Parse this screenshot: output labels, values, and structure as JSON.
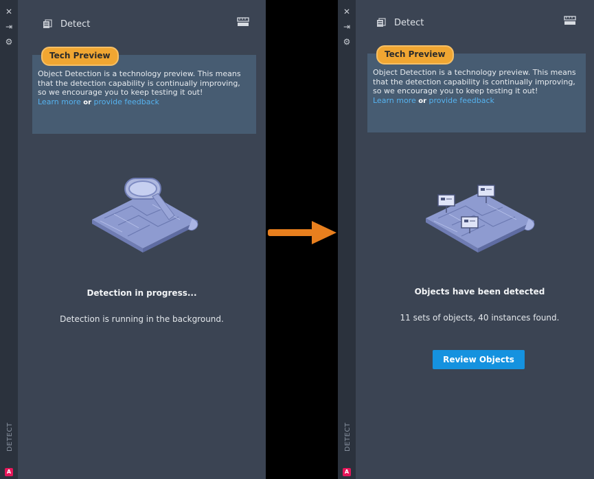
{
  "panels": {
    "left": {
      "title": "Detect",
      "badge": "Tech Preview",
      "info_text": "Object Detection is a technology preview. This means that the detection capability is continually improving, so we encourage you to keep testing it out!",
      "learn_more": "Learn more",
      "or": "or",
      "feedback": "provide feedback",
      "status_title": "Detection in progress...",
      "status_text": "Detection is running in the background.",
      "side_label": "DETECT",
      "side_icons": [
        "close-icon",
        "pin-icon",
        "settings-icon"
      ]
    },
    "right": {
      "title": "Detect",
      "badge": "Tech Preview",
      "info_text": "Object Detection is a technology preview. This means that the detection capability is continually improving, so we encourage you to keep testing it out!",
      "learn_more": "Learn more",
      "or": "or",
      "feedback": "provide feedback",
      "status_title": "Objects have been detected",
      "status_text": "11 sets of objects, 40 instances found.",
      "button_label": "Review Objects",
      "side_label": "DETECT",
      "side_icons": [
        "close-icon",
        "pin-icon",
        "settings-icon"
      ]
    }
  },
  "colors": {
    "panel_bg": "#3b4453",
    "strip_bg": "#2b323d",
    "info_bg": "#475c72",
    "badge": "#f0a632",
    "link": "#56b3f0",
    "button": "#1592df",
    "arrow": "#e87f1e"
  }
}
